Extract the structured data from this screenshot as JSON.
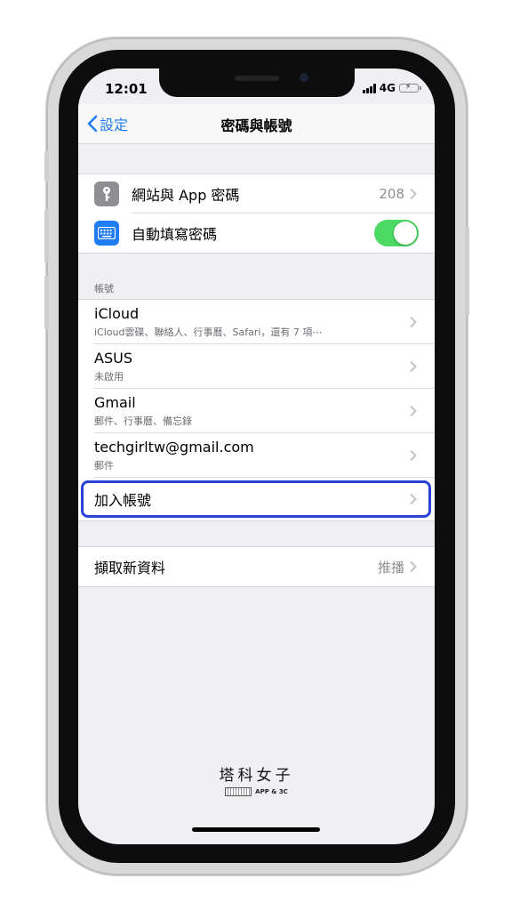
{
  "status": {
    "time": "12:01",
    "network": "4G"
  },
  "nav": {
    "back_label": "設定",
    "title": "密碼與帳號"
  },
  "passwords": {
    "website_label": "網站與 App 密碼",
    "website_count": "208",
    "autofill_label": "自動填寫密碼",
    "autofill_enabled": true
  },
  "accounts": {
    "header": "帳號",
    "items": [
      {
        "title": "iCloud",
        "subtitle": "iCloud雲碟、聯絡人、行事曆、Safari，還有 7 項⋯"
      },
      {
        "title": "ASUS",
        "subtitle": "未啟用"
      },
      {
        "title": "Gmail",
        "subtitle": "郵件、行事曆、備忘錄"
      },
      {
        "title": "techgirltw@gmail.com",
        "subtitle": "郵件"
      }
    ],
    "add_label": "加入帳號"
  },
  "fetch": {
    "label": "擷取新資料",
    "value": "推播"
  },
  "watermark": {
    "title": "塔科女子",
    "subtitle": "APP & 3C"
  },
  "colors": {
    "accent": "#1f7cf2",
    "toggle_on": "#4cd964",
    "highlight": "#2a43d6"
  },
  "icons": {
    "key": "key-icon",
    "keyboard": "keyboard-icon",
    "chevron": "chevron-right-icon",
    "back": "chevron-left-icon"
  }
}
